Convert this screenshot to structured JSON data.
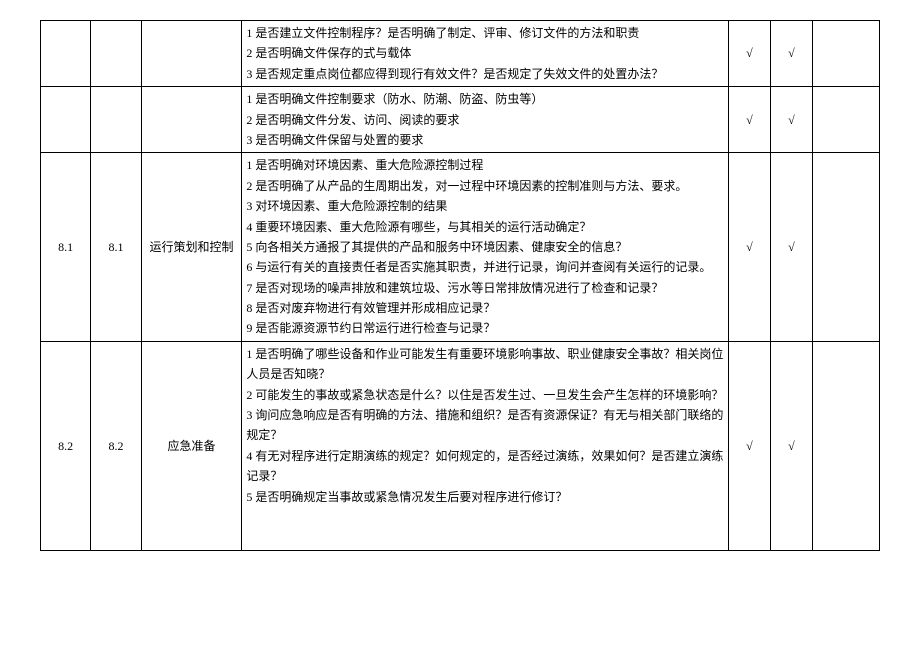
{
  "rows": [
    {
      "col1": "",
      "col2": "",
      "col3": "",
      "content": "1 是否建立文件控制程序？是否明确了制定、评审、修订文件的方法和职责\n2 是否明确文件保存的式与载体\n3 是否规定重点岗位都应得到现行有效文件？是否规定了失效文件的处置办法？",
      "check1": "√",
      "check2": "√",
      "remark": ""
    },
    {
      "col1": "",
      "col2": "",
      "col3": "",
      "content": "1 是否明确文件控制要求（防水、防潮、防盗、防虫等）\n2 是否明确文件分发、访问、阅读的要求\n3 是否明确文件保留与处置的要求",
      "check1": "√",
      "check2": "√",
      "remark": ""
    },
    {
      "col1": "8.1",
      "col2": "8.1",
      "col3": "运行策划和控制",
      "content": "1 是否明确对环境因素、重大危险源控制过程\n2 是否明确了从产品的生周期出发，对一过程中环境因素的控制准则与方法、要求。\n3 对环境因素、重大危险源控制的结果\n4 重要环境因素、重大危险源有哪些，与其相关的运行活动确定？\n5 向各相关方通报了其提供的产品和服务中环境因素、健康安全的信息？\n6 与运行有关的直接责任者是否实施其职责，并进行记录，询问并查阅有关运行的记录。\n7 是否对现场的噪声排放和建筑垃圾、污水等日常排放情况进行了检查和记录？\n8 是否对废弃物进行有效管理并形成相应记录？\n9 是否能源资源节约日常运行进行检查与记录？",
      "check1": "√",
      "check2": "√",
      "remark": ""
    },
    {
      "col1": "8.2",
      "col2": "8.2",
      "col3": "应急准备",
      "content": "1 是否明确了哪些设备和作业可能发生有重要环境影响事故、职业健康安全事故？相关岗位人员是否知晓？\n2 可能发生的事故或紧急状态是什么？以住是否发生过、一旦发生会产生怎样的环境影响？\n3 询问应急响应是否有明确的方法、措施和组织？是否有资源保证？有无与相关部门联络的规定？\n4 有无对程序进行定期演练的规定？如何规定的，是否经过演练，效果如何？是否建立演练记录？\n5 是否明确规定当事故或紧急情况发生后要对程序进行修订？\n\n\n",
      "check1": "√",
      "check2": "√",
      "remark": ""
    }
  ]
}
